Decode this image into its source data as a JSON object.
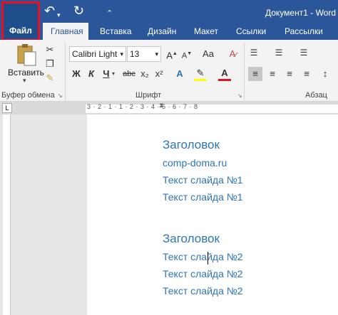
{
  "window": {
    "title": "Документ1 - Word"
  },
  "quick_access": {
    "save_icon": "save-icon",
    "undo_icon": "undo-icon",
    "redo_icon": "redo-icon",
    "customize_icon": "customize-icon"
  },
  "ribbon_tabs": [
    {
      "label": "Файл",
      "active": false
    },
    {
      "label": "Главная",
      "active": true
    },
    {
      "label": "Вставка",
      "active": false
    },
    {
      "label": "Дизайн",
      "active": false
    },
    {
      "label": "Макет",
      "active": false
    },
    {
      "label": "Ссылки",
      "active": false
    },
    {
      "label": "Рассылки",
      "active": false
    }
  ],
  "clipboard": {
    "paste_label": "Вставить",
    "group_label": "Буфер обмена"
  },
  "font": {
    "name": "Calibri Light",
    "size": "13",
    "group_label": "Шрифт",
    "bold": "Ж",
    "italic": "К",
    "underline": "Ч",
    "strike": "abc",
    "subscript": "x₂",
    "superscript": "x²"
  },
  "paragraph": {
    "group_label": "Абзац"
  },
  "ruler": {
    "ticks": "3 · 2 · 1 · 1 · 2 · 3 · 4 · 5 · 6 · 7 · 8"
  },
  "document": {
    "lines": [
      "Заголовок",
      "comp-doma.ru",
      "Текст слайда №1",
      "Текст слайда №1",
      "Заголовок",
      "Текст слайда №2",
      "Текст слайда №2",
      "Текст слайда №2"
    ]
  },
  "colors": {
    "accent": "#2b579a",
    "highlight_border": "#e81123",
    "heading_text": "#2e75b6"
  }
}
